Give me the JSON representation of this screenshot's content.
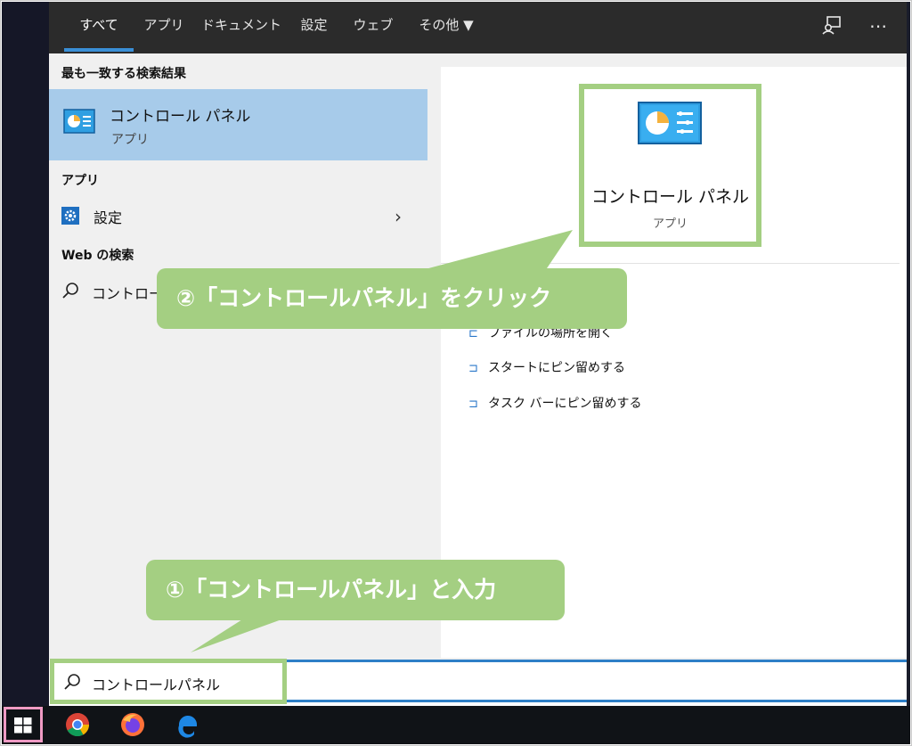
{
  "tabs": [
    {
      "label": "すべて",
      "active": true
    },
    {
      "label": "アプリ"
    },
    {
      "label": "ドキュメント"
    },
    {
      "label": "設定"
    },
    {
      "label": "ウェブ"
    },
    {
      "label": "その他 ▼"
    }
  ],
  "toolbar_icons": [
    "feedback-icon",
    "more-icon"
  ],
  "left": {
    "best_match_header": "最も一致する検索結果",
    "best_match": {
      "title": "コントロール パネル",
      "subtitle": "アプリ",
      "icon": "control-panel-icon"
    },
    "apps_header": "アプリ",
    "apps": [
      {
        "label": "設定",
        "icon": "gear-icon"
      }
    ],
    "web_header": "Web の検索",
    "web": [
      {
        "label": "コントロール",
        "icon": "search-icon"
      }
    ]
  },
  "detail": {
    "title": "コントロール パネル",
    "subtitle": "アプリ",
    "actions": [
      {
        "label": "ファイルの場所を開く",
        "icon": "folder-open-icon"
      },
      {
        "label": "スタートにピン留めする",
        "icon": "pin-icon"
      },
      {
        "label": "タスク バーにピン留めする",
        "icon": "pin-icon"
      }
    ]
  },
  "search": {
    "value": "コントロールパネル",
    "icon": "search-icon"
  },
  "annotations": {
    "step1": "①「コントロールパネル」と入力",
    "step2": "②「コントロールパネル」をクリック"
  },
  "taskbar": [
    "windows-start-icon",
    "chrome-icon",
    "firefox-icon",
    "edge-icon"
  ],
  "colors": {
    "highlight": "#a7cbea",
    "callout": "#a4cf82",
    "accent": "#3a8fd6",
    "start_outline": "#ef9ac4"
  }
}
